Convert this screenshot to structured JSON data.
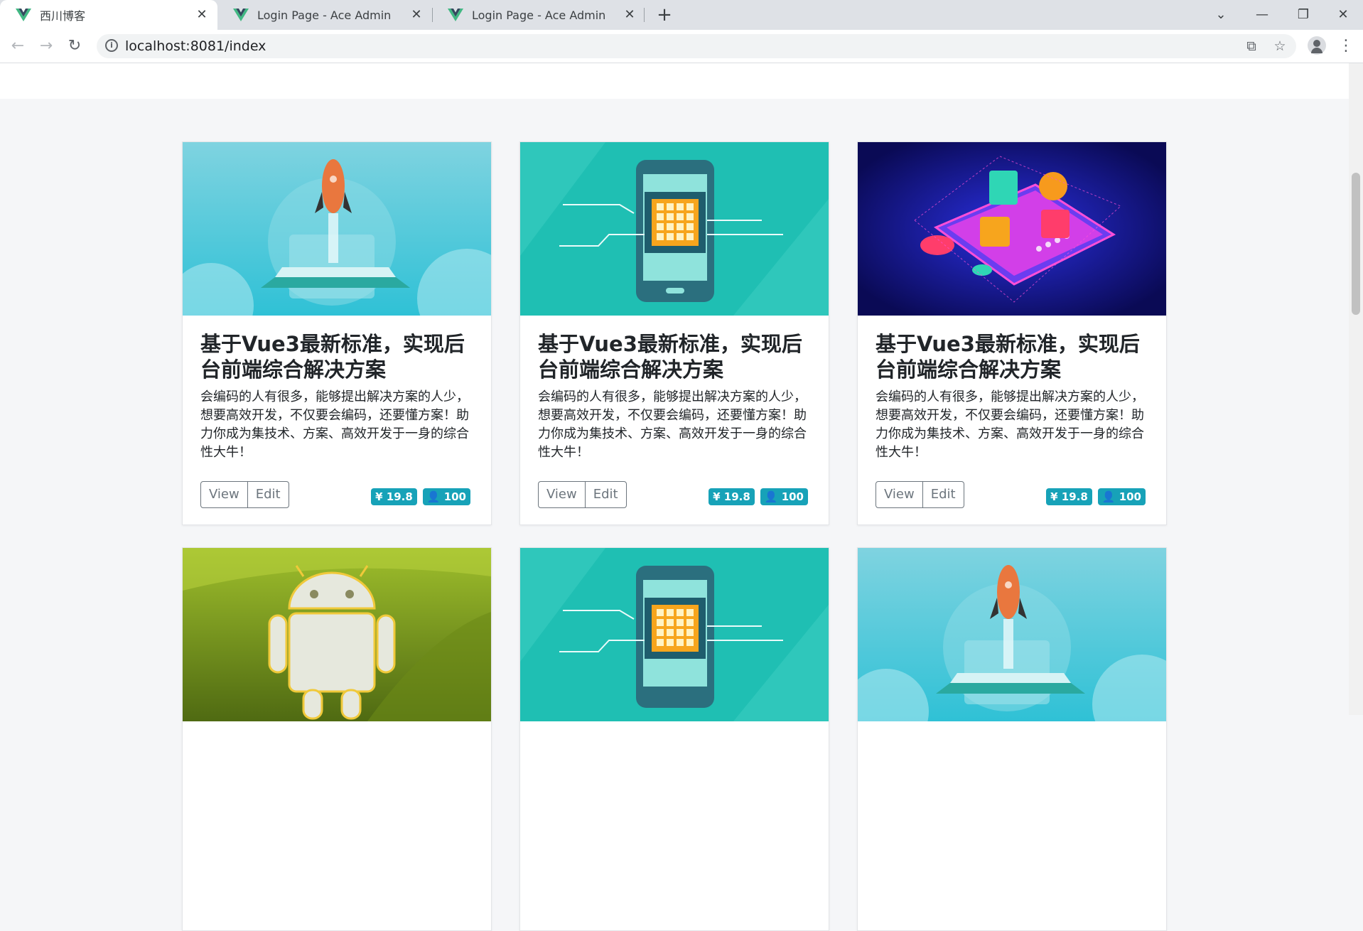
{
  "browser": {
    "tabs": [
      {
        "title": "西川博客"
      },
      {
        "title": "Login Page - Ace Admin"
      },
      {
        "title": "Login Page - Ace Admin"
      }
    ],
    "new_tab": "+",
    "address": "localhost:8081/index"
  },
  "cards": [
    {
      "image": "rocket-illustration",
      "title": "基于Vue3最新标准，实现后台前端综合解决方案",
      "text": "会编码的人有很多，能够提出解决方案的人少，想要高效开发，不仅要会编码，还要懂方案！助力你成为集技术、方案、高效开发于一身的综合性大牛！",
      "view": "View",
      "edit": "Edit",
      "price": "¥ 19.8",
      "count": "100"
    },
    {
      "image": "chip-phone-illustration",
      "title": "基于Vue3最新标准，实现后台前端综合解决方案",
      "text": "会编码的人有很多，能够提出解决方案的人少，想要高效开发，不仅要会编码，还要懂方案！助力你成为集技术、方案、高效开发于一身的综合性大牛！",
      "view": "View",
      "edit": "Edit",
      "price": "¥ 19.8",
      "count": "100"
    },
    {
      "image": "social-phone-illustration",
      "title": "基于Vue3最新标准，实现后台前端综合解决方案",
      "text": "会编码的人有很多，能够提出解决方案的人少，想要高效开发，不仅要会编码，还要懂方案！助力你成为集技术、方案、高效开发于一身的综合性大牛！",
      "view": "View",
      "edit": "Edit",
      "price": "¥ 19.8",
      "count": "100"
    },
    {
      "image": "android-illustration"
    },
    {
      "image": "chip-phone-illustration"
    },
    {
      "image": "rocket-illustration"
    }
  ],
  "colors": {
    "badge": "#17a2b8",
    "button_border": "#6c757d"
  }
}
